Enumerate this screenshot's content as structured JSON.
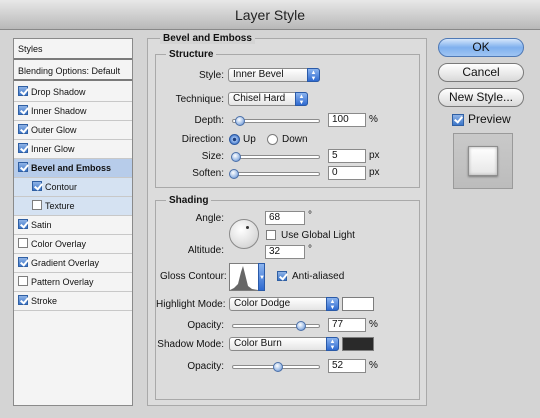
{
  "window": {
    "title": "Layer Style"
  },
  "left_panel": {
    "styles_label": "Styles",
    "blending_label": "Blending Options: Default",
    "items": [
      {
        "label": "Drop Shadow",
        "checked": true
      },
      {
        "label": "Inner Shadow",
        "checked": true
      },
      {
        "label": "Outer Glow",
        "checked": true
      },
      {
        "label": "Inner Glow",
        "checked": true
      },
      {
        "label": "Bevel and Emboss",
        "checked": true
      },
      {
        "label": "Contour",
        "checked": true
      },
      {
        "label": "Texture",
        "checked": false
      },
      {
        "label": "Satin",
        "checked": true
      },
      {
        "label": "Color Overlay",
        "checked": false
      },
      {
        "label": "Gradient Overlay",
        "checked": true
      },
      {
        "label": "Pattern Overlay",
        "checked": false
      },
      {
        "label": "Stroke",
        "checked": true
      }
    ]
  },
  "bevel": {
    "section_title": "Bevel and Emboss",
    "structure_title": "Structure",
    "style_label": "Style:",
    "style_value": "Inner Bevel",
    "technique_label": "Technique:",
    "technique_value": "Chisel Hard",
    "depth_label": "Depth:",
    "depth_value": "100",
    "depth_unit": "%",
    "direction_label": "Direction:",
    "direction_up": "Up",
    "direction_down": "Down",
    "direction_selected": "Up",
    "size_label": "Size:",
    "size_value": "5",
    "size_unit": "px",
    "soften_label": "Soften:",
    "soften_value": "0",
    "soften_unit": "px"
  },
  "shading": {
    "title": "Shading",
    "angle_label": "Angle:",
    "angle_value": "68",
    "angle_unit": "°",
    "global_light_label": "Use Global Light",
    "global_light_checked": false,
    "altitude_label": "Altitude:",
    "altitude_value": "32",
    "altitude_unit": "°",
    "gloss_label": "Gloss Contour:",
    "antialiased_label": "Anti-aliased",
    "antialiased_checked": true,
    "highlight_label": "Highlight Mode:",
    "highlight_value": "Color Dodge",
    "highlight_color": "#ffffff",
    "hl_opacity_label": "Opacity:",
    "hl_opacity_value": "77",
    "hl_opacity_unit": "%",
    "shadow_label": "Shadow Mode:",
    "shadow_value": "Color Burn",
    "shadow_color": "#2a2a2a",
    "sh_opacity_label": "Opacity:",
    "sh_opacity_value": "52",
    "sh_opacity_unit": "%"
  },
  "buttons": {
    "ok": "OK",
    "cancel": "Cancel",
    "new_style": "New Style...",
    "preview_label": "Preview",
    "preview_checked": true
  }
}
